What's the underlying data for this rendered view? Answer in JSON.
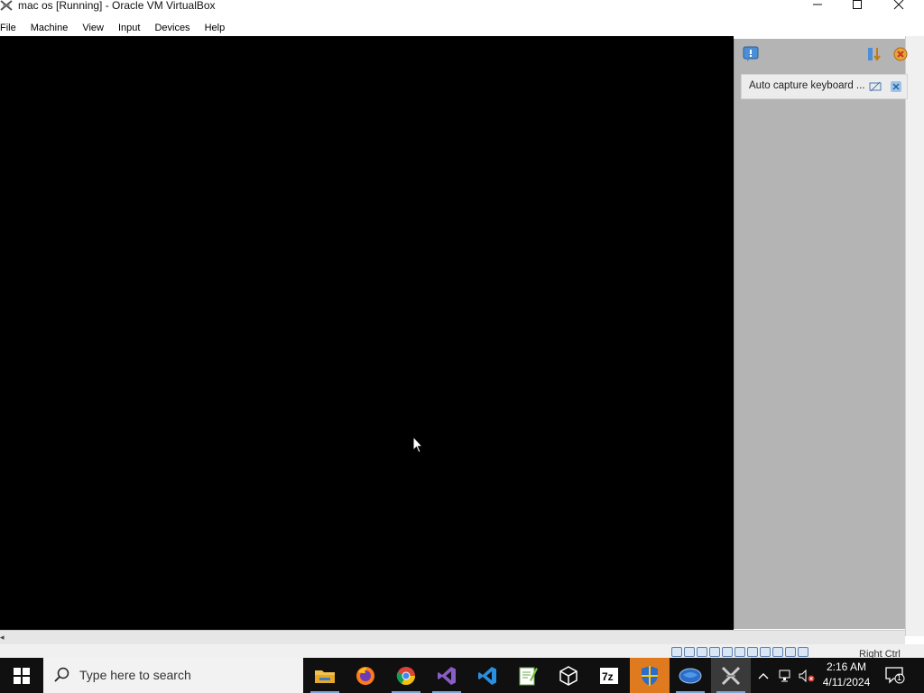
{
  "window": {
    "title": "mac os [Running] - Oracle VM VirtualBox"
  },
  "menu": {
    "items": [
      "File",
      "Machine",
      "View",
      "Input",
      "Devices",
      "Help"
    ]
  },
  "notification_panel": {
    "message": "Auto capture keyboard ..."
  },
  "statusbar": {
    "host_key": "Right Ctrl"
  },
  "taskbar": {
    "search_placeholder": "Type here to search",
    "apps": [
      "file-explorer-icon",
      "firefox-icon",
      "chrome-icon",
      "visual-studio-icon",
      "vscode-icon",
      "notepad-plus-plus-icon",
      "virtualbox-box-icon",
      "7zip-icon",
      "shield-icon",
      "globe-app-icon",
      "virtualbox-icon"
    ],
    "time": "2:16 AM",
    "date": "4/11/2024",
    "notification_count": "1"
  },
  "colors": {
    "vm_background": "#000000",
    "panel_background": "#b4b4b4",
    "taskbar": "#101010",
    "accent": "#7aa7d8"
  }
}
